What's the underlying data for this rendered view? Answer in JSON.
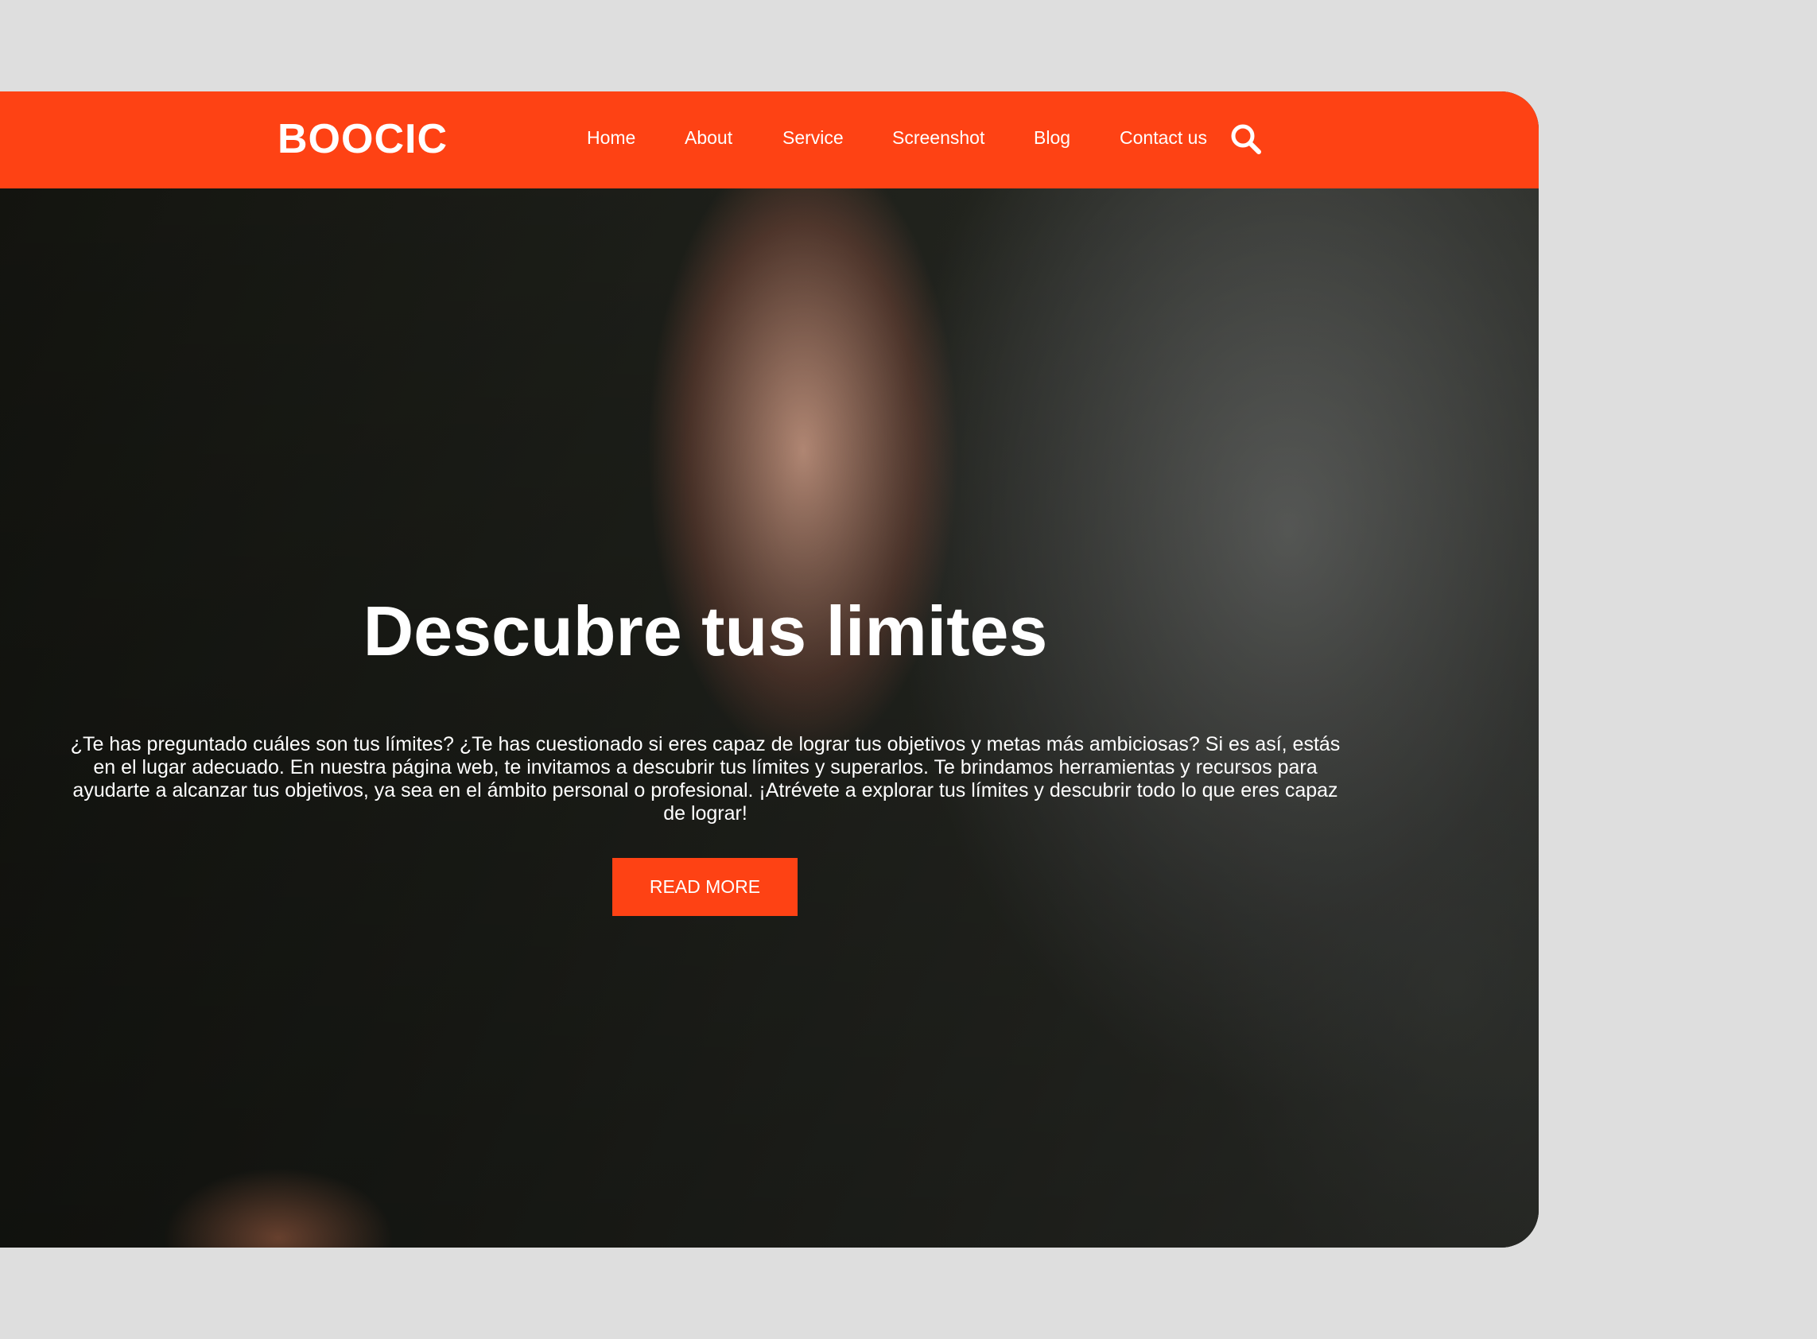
{
  "header": {
    "logo": "BOOCIC",
    "nav": [
      "Home",
      "About",
      "Service",
      "Screenshot",
      "Blog",
      "Contact us"
    ],
    "search_icon": "search-icon"
  },
  "hero": {
    "title": "Descubre tus limites",
    "body": "¿Te has preguntado cuáles son tus límites? ¿Te has cuestionado si eres capaz de lograr tus objetivos y metas más ambiciosas? Si es así, estás en el lugar adecuado. En nuestra página web, te invitamos a descubrir tus límites y superarlos. Te brindamos herramientas y recursos para ayudarte a alcanzar tus objetivos, ya sea en el ámbito personal o profesional. ¡Atrévete a explorar tus límites y descubrir todo lo que eres capaz de lograr!",
    "button": "READ MORE"
  },
  "colors": {
    "accent": "#fe4214",
    "page_background": "#dedede"
  }
}
